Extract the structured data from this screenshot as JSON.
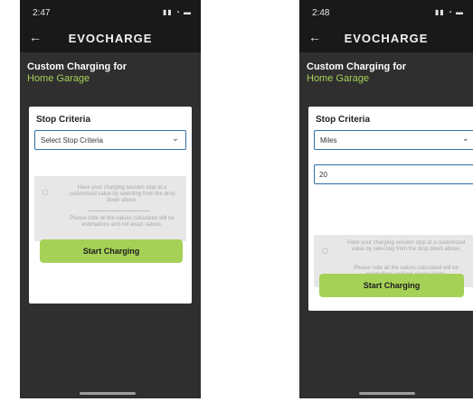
{
  "screen_1": {
    "status": {
      "time": "2:47",
      "icons": "▮▮ ◔ ▬"
    },
    "app_bar": {
      "back_glyph": "←",
      "title": "EVOCHARGE"
    },
    "heading": "Custom Charging for",
    "location": "Home Garage",
    "card": {
      "title": "Stop Criteria",
      "select_value": "Select Stop Criteria",
      "info_text_1": "Have your charging session stop at a customized value by selecting from the drop down above.",
      "info_text_2": "Please note all the values calculated will be estimations and not exact values.",
      "start_label": "Start Charging"
    }
  },
  "screen_2": {
    "status": {
      "time": "2:48",
      "icons": "▮▮ ◔ ▬"
    },
    "app_bar": {
      "back_glyph": "←",
      "title": "EVOCHARGE"
    },
    "heading": "Custom Charging for",
    "location": "Home Garage",
    "card": {
      "title": "Stop Criteria",
      "select_value": "Miles",
      "input_value": "20",
      "info_text_1": "Have your charging session stop at a customized value by selecting from the drop down above.",
      "info_text_2": "Please note all the values calculated will be estimations and not exact values.",
      "start_label": "Start Charging"
    }
  },
  "icons": {
    "chevron": "⌄",
    "bulb": "☼"
  },
  "colors": {
    "accent": "#a6d157",
    "background": "#2f2f2f",
    "topbar": "#191919",
    "focus": "#2f6fa8"
  }
}
